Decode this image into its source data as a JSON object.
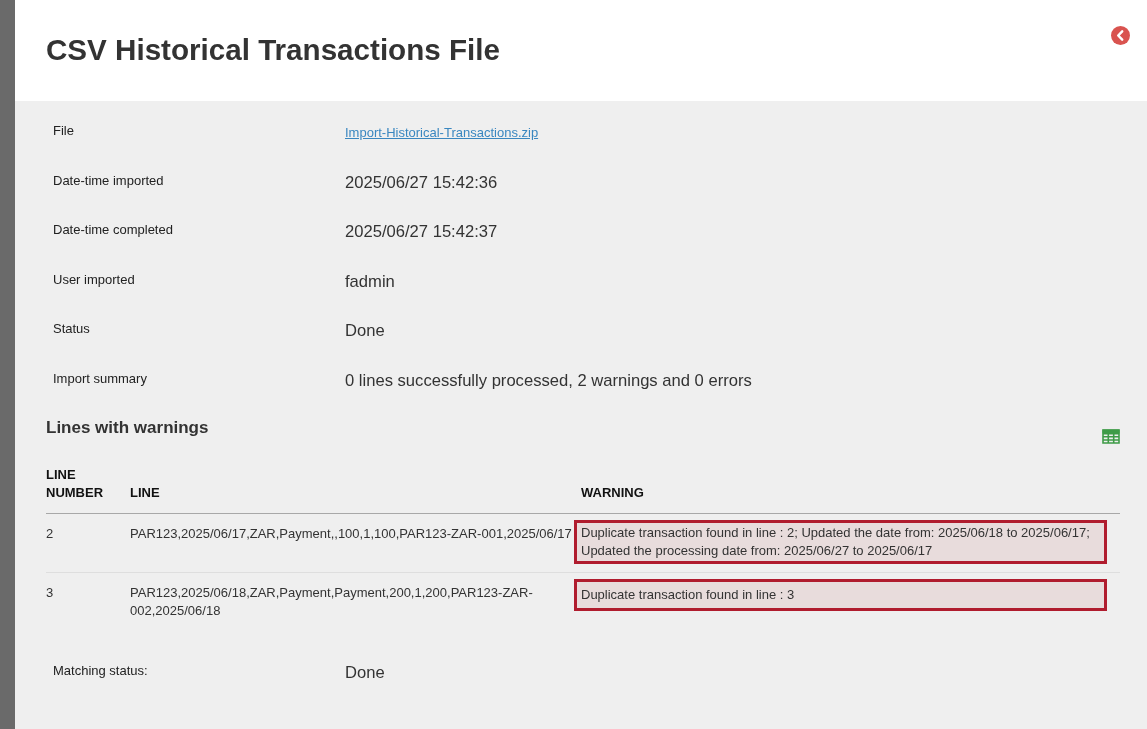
{
  "header": {
    "title": "CSV Historical Transactions File"
  },
  "details": [
    {
      "label": "File",
      "value": "Import-Historical-Transactions.zip",
      "kind": "link"
    },
    {
      "label": "Date-time imported",
      "value": "2025/06/27 15:42:36",
      "kind": "text"
    },
    {
      "label": "Date-time completed",
      "value": "2025/06/27 15:42:37",
      "kind": "text"
    },
    {
      "label": "User imported",
      "value": "fadmin",
      "kind": "text"
    },
    {
      "label": "Status",
      "value": "Done",
      "kind": "text"
    },
    {
      "label": "Import summary",
      "value": "0 lines successfully processed, 2 warnings and 0 errors",
      "kind": "text"
    }
  ],
  "warnings_section": {
    "title": "Lines with warnings",
    "table": {
      "columns": [
        "LINE NUMBER",
        "LINE",
        "WARNING"
      ],
      "rows": [
        {
          "line_number": "2",
          "line": "PAR123,2025/06/17,ZAR,Payment,,100,1,100,PAR123-ZAR-001,2025/06/17",
          "warning": "Duplicate transaction found in line : 2; Updated the date from: 2025/06/18 to 2025/06/17; Updated the processing date from: 2025/06/27 to 2025/06/17"
        },
        {
          "line_number": "3",
          "line": "PAR123,2025/06/18,ZAR,Payment,Payment,200,1,200,PAR123-ZAR-002,2025/06/18",
          "warning": "Duplicate transaction found in line : 3"
        }
      ]
    }
  },
  "matching_status": {
    "label": "Matching status:",
    "value": "Done"
  }
}
